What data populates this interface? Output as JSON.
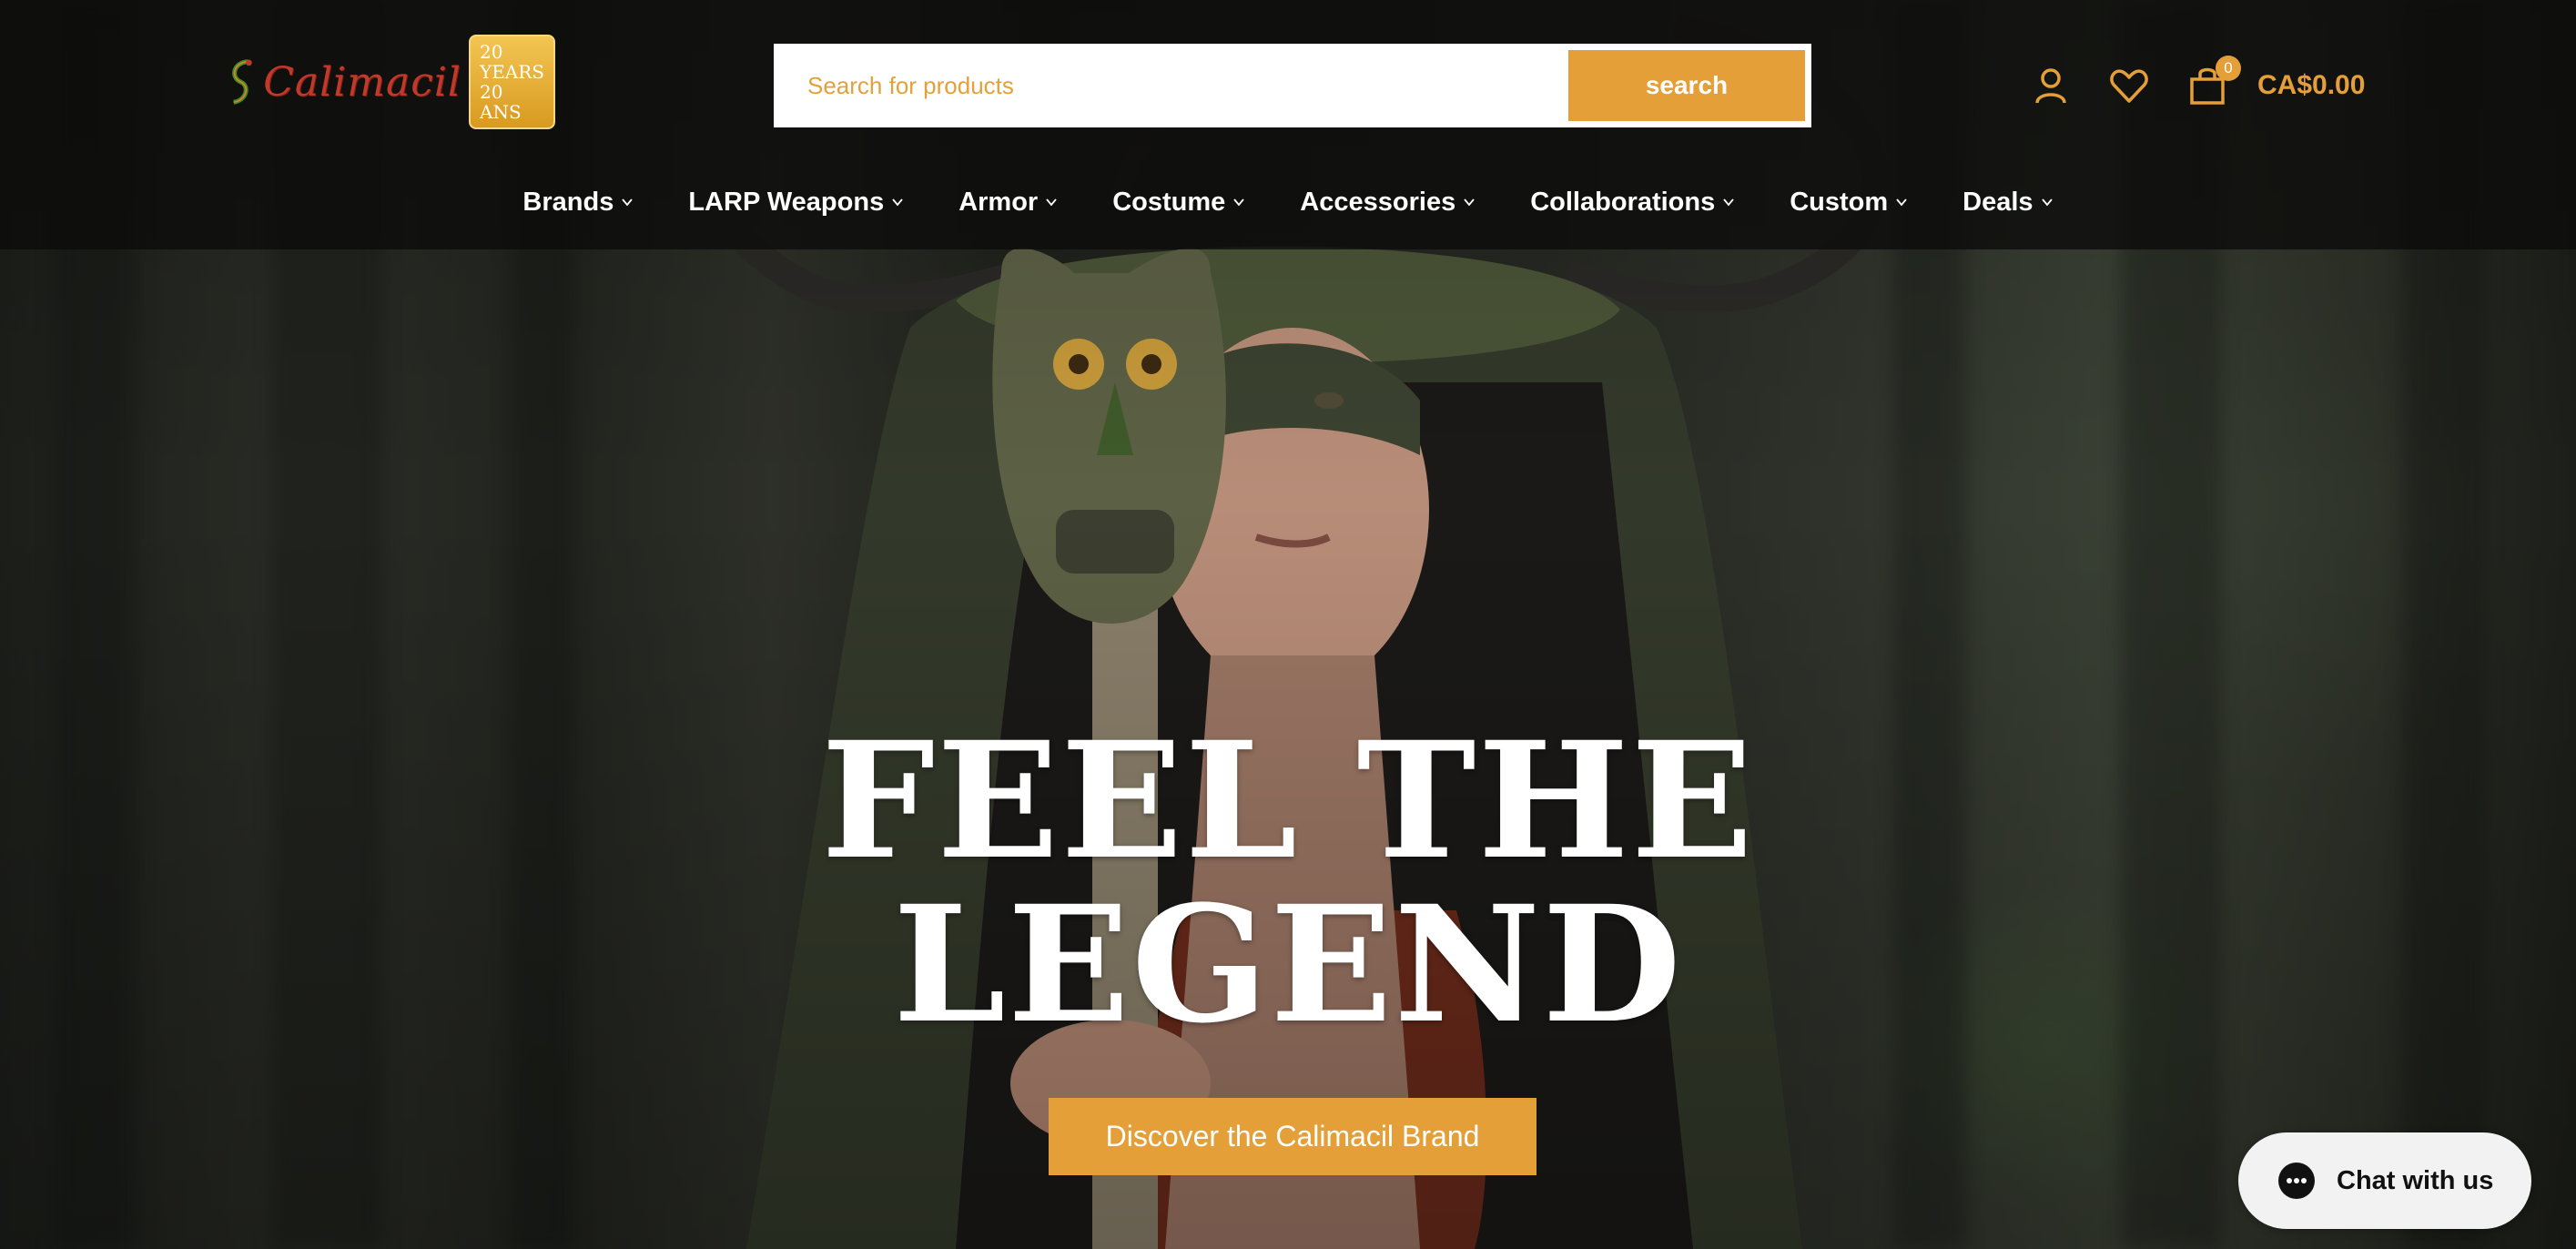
{
  "header": {
    "logo": {
      "text": "Calimacil",
      "badge_line1": "20 YEARS",
      "badge_line2": "20 ANS"
    },
    "search": {
      "placeholder": "Search for products",
      "button_label": "search"
    },
    "icons": [
      "account-icon",
      "wishlist-heart-icon",
      "shopping-bag-icon"
    ],
    "cart": {
      "count": "0",
      "total": "CA$0.00"
    }
  },
  "nav": {
    "items": [
      {
        "label": "Brands"
      },
      {
        "label": "LARP Weapons"
      },
      {
        "label": "Armor"
      },
      {
        "label": "Costume"
      },
      {
        "label": "Accessories"
      },
      {
        "label": "Collaborations"
      },
      {
        "label": "Custom"
      },
      {
        "label": "Deals"
      }
    ]
  },
  "hero": {
    "title_line1": "FEEL THE",
    "title_line2": "LEGEND",
    "cta_label": "Discover the Calimacil Brand"
  },
  "chat": {
    "label": "Chat with us"
  },
  "colors": {
    "accent": "#e49f38",
    "header_bg": "#0c0c0a",
    "text_light": "#ffffff"
  }
}
